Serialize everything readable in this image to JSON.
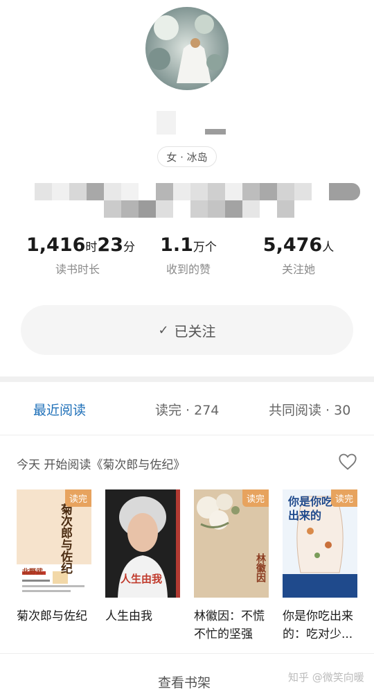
{
  "profile": {
    "gender_location": "女 · 冰岛"
  },
  "stats": [
    {
      "value": "1,416",
      "unit1": "时",
      "value2": "23",
      "unit2": "分",
      "label": "读书时长"
    },
    {
      "value": "1.1",
      "unit1": "万个",
      "label": "收到的赞"
    },
    {
      "value": "5,476",
      "unit1": "人",
      "label": "关注她"
    }
  ],
  "follow_button": {
    "label": "已关注",
    "icon": "check-icon"
  },
  "tabs": [
    {
      "label": "最近阅读",
      "active": true
    },
    {
      "label": "读完 · 274",
      "active": false
    },
    {
      "label": "共同阅读 · 30",
      "active": false
    }
  ],
  "recent": {
    "heading": "今天 开始阅读《菊次郎与佐纪》",
    "books": [
      {
        "title": "菊次郎与佐纪",
        "badge": "读完",
        "cover_text": "菊次郎与佐纪",
        "author": "北野武"
      },
      {
        "title": "人生由我",
        "badge": "",
        "cover_text": "人生由我"
      },
      {
        "title": "林徽因：不慌不忙的坚强",
        "badge": "读完",
        "cover_text": "林徽因"
      },
      {
        "title": "你是你吃出来的：吃对少...",
        "badge": "读完",
        "cover_text": "你是你吃出来的"
      }
    ]
  },
  "bookshelf_link": "查看书架",
  "watermark": "知乎 @微笑向暖",
  "colors": {
    "accent": "#1d6fb8",
    "badge": "#e7a35e"
  }
}
